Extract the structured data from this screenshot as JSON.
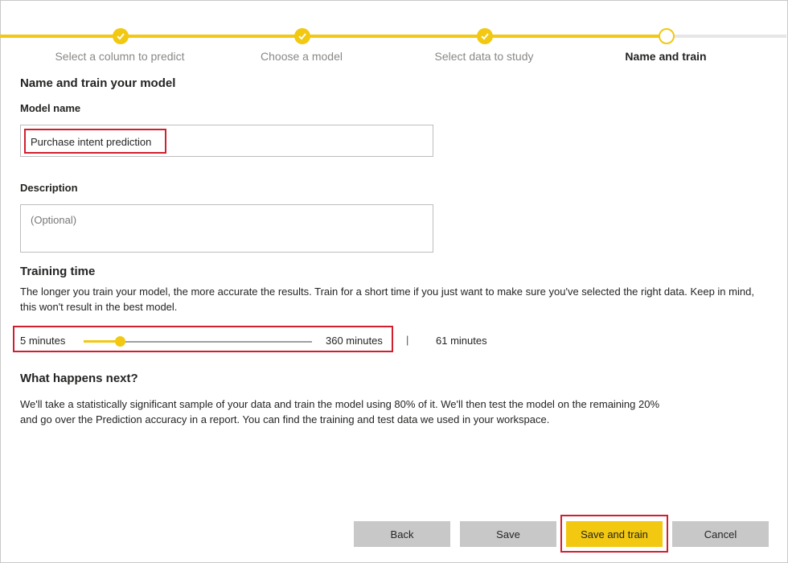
{
  "steps": [
    {
      "label": "Select a column to predict",
      "status": "done"
    },
    {
      "label": "Choose a model",
      "status": "done"
    },
    {
      "label": "Select data to study",
      "status": "done"
    },
    {
      "label": "Name and train",
      "status": "current"
    }
  ],
  "heading": "Name and train your model",
  "model_name": {
    "label": "Model name",
    "value": "Purchase intent prediction"
  },
  "description": {
    "label": "Description",
    "placeholder": "(Optional)"
  },
  "training_time": {
    "title": "Training time",
    "text": "The longer you train your model, the more accurate the results. Train for a short time if you just want to make sure you've selected the right data. Keep in mind, this won't result in the best model.",
    "min_label": "5 minutes",
    "max_label": "360 minutes",
    "separator": "|",
    "current_label": "61 minutes",
    "slider_fraction": 0.16
  },
  "next": {
    "title": "What happens next?",
    "text": "We'll take a statistically significant sample of your data and train the model using 80% of it. We'll then test the model on the remaining 20% and go over the Prediction accuracy in a report. You can find the training and test data we used in your workspace."
  },
  "buttons": {
    "back": "Back",
    "save": "Save",
    "save_and_train": "Save and train",
    "cancel": "Cancel"
  },
  "colors": {
    "accent": "#f2c811",
    "highlight": "#d0202f"
  }
}
